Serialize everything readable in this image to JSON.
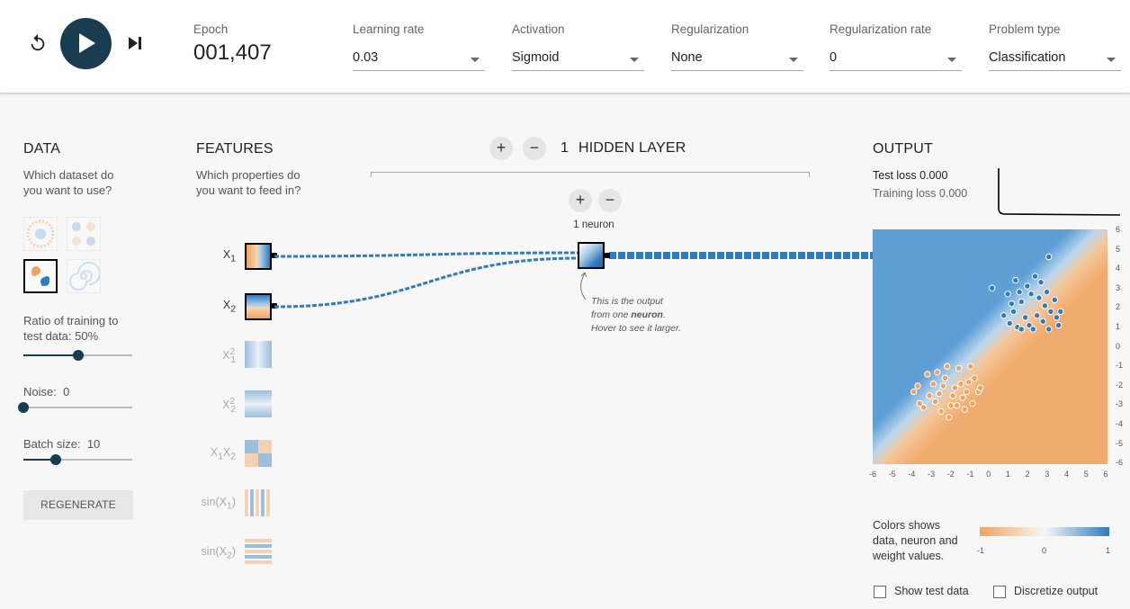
{
  "controls": {
    "reset_icon": "reset-icon",
    "play_icon": "play-icon",
    "step_icon": "step-forward-icon",
    "epoch_label": "Epoch",
    "epoch_value": "001,407"
  },
  "selects": {
    "learning_rate": {
      "label": "Learning rate",
      "value": "0.03"
    },
    "activation": {
      "label": "Activation",
      "value": "Sigmoid"
    },
    "regularization": {
      "label": "Regularization",
      "value": "None"
    },
    "regularization_rate": {
      "label": "Regularization rate",
      "value": "0"
    },
    "problem_type": {
      "label": "Problem type",
      "value": "Classification"
    }
  },
  "data_panel": {
    "title": "DATA",
    "subtitle": "Which dataset do you want to use?",
    "selected_dataset": "gaussian",
    "ratio_label": "Ratio of training to test data:",
    "ratio_value": "50%",
    "ratio_fraction": 0.5,
    "noise_label": "Noise:",
    "noise_value": "0",
    "noise_fraction": 0,
    "batch_label": "Batch size:",
    "batch_value": "10",
    "batch_fraction": 0.3,
    "regenerate": "REGENERATE"
  },
  "features_panel": {
    "title": "FEATURES",
    "subtitle": "Which properties do you want to feed in?",
    "features": [
      {
        "id": "x1",
        "base": "X",
        "sub": "1",
        "sup": "",
        "active": true
      },
      {
        "id": "x2",
        "base": "X",
        "sub": "2",
        "sup": "",
        "active": true
      },
      {
        "id": "x1sq",
        "base": "X",
        "sub": "1",
        "sup": "2",
        "active": false
      },
      {
        "id": "x2sq",
        "base": "X",
        "sub": "2",
        "sup": "2",
        "active": false
      },
      {
        "id": "x1x2",
        "base": "X1X2",
        "sub": "",
        "sup": "",
        "active": false
      },
      {
        "id": "sinx1",
        "base": "sin(X",
        "sub": "1",
        "sup": ")",
        "active": false
      },
      {
        "id": "sinx2",
        "base": "sin(X",
        "sub": "2",
        "sup": ")",
        "active": false
      }
    ]
  },
  "network": {
    "hidden_count": "1",
    "hidden_label": "HIDDEN LAYER",
    "neuron_count_label": "1 neuron",
    "plus": "+",
    "minus": "−",
    "callout_1": "This is the output from one ",
    "callout_bold": "neuron",
    "callout_2": ". Hover to see it larger."
  },
  "output_panel": {
    "title": "OUTPUT",
    "test_loss_label": "Test loss",
    "test_loss": "0.000",
    "training_loss_label": "Training loss",
    "training_loss": "0.000",
    "y_ticks": [
      "6",
      "5",
      "4",
      "3",
      "2",
      "1",
      "0",
      "-1",
      "-2",
      "-3",
      "-4",
      "-5",
      "-6"
    ],
    "x_ticks": [
      "-6",
      "-5",
      "-4",
      "-3",
      "-2",
      "-1",
      "0",
      "1",
      "2",
      "3",
      "4",
      "5",
      "6"
    ],
    "legend_text": "Colors shows data, neuron and weight values.",
    "legend_ticks": [
      "-1",
      "0",
      "1"
    ],
    "show_test_label": "Show test data",
    "discretize_label": "Discretize output"
  },
  "colors": {
    "positive": "#2e7bc0",
    "negative": "#f0a35e",
    "accent": "#183d4e"
  },
  "chart_data": {
    "type": "scatter",
    "xlim": [
      -6,
      6
    ],
    "ylim": [
      -6,
      6
    ],
    "series": [
      {
        "values": [
          [
            2.1,
            2.7
          ],
          [
            1.6,
            2.3
          ],
          [
            2.4,
            1.6
          ],
          [
            2.0,
            1.1
          ],
          [
            1.2,
            1.8
          ],
          [
            2.8,
            2.1
          ],
          [
            3.1,
            1.8
          ],
          [
            3.4,
            1.5
          ],
          [
            1.9,
            3.1
          ],
          [
            2.6,
            3.3
          ],
          [
            1.3,
            3.4
          ],
          [
            0.9,
            2.7
          ],
          [
            0.7,
            1.6
          ],
          [
            1.4,
            1.0
          ],
          [
            2.2,
            0.9
          ],
          [
            3.0,
            0.9
          ],
          [
            3.5,
            1.1
          ],
          [
            2.5,
            2.5
          ],
          [
            1.8,
            1.5
          ],
          [
            2.9,
            2.8
          ],
          [
            1.1,
            2.2
          ],
          [
            2.3,
            3.6
          ],
          [
            3.3,
            2.4
          ],
          [
            1.5,
            2.8
          ],
          [
            2.7,
            1.3
          ],
          [
            3.0,
            4.6
          ],
          [
            0.1,
            3.0
          ],
          [
            1.0,
            1.2
          ],
          [
            3.6,
            1.8
          ],
          [
            1.6,
            0.9
          ]
        ]
      },
      {
        "values": [
          [
            -1.8,
            -2.1
          ],
          [
            -2.3,
            -1.6
          ],
          [
            -1.4,
            -2.6
          ],
          [
            -2.0,
            -3.0
          ],
          [
            -1.1,
            -1.8
          ],
          [
            -2.6,
            -2.4
          ],
          [
            -2.9,
            -1.9
          ],
          [
            -3.1,
            -2.5
          ],
          [
            -1.6,
            -1.1
          ],
          [
            -2.2,
            -1.0
          ],
          [
            -0.9,
            -2.9
          ],
          [
            -1.3,
            -3.2
          ],
          [
            -2.5,
            -3.3
          ],
          [
            -0.8,
            -1.6
          ],
          [
            -1.0,
            -1.0
          ],
          [
            -3.2,
            -1.4
          ],
          [
            -3.7,
            -2.0
          ],
          [
            -2.8,
            -2.8
          ],
          [
            -1.9,
            -2.5
          ],
          [
            -2.4,
            -2.0
          ],
          [
            -1.5,
            -1.9
          ],
          [
            -0.6,
            -2.3
          ],
          [
            -3.4,
            -3.1
          ],
          [
            -2.1,
            -3.6
          ],
          [
            -1.2,
            -2.3
          ],
          [
            -3.9,
            -2.3
          ],
          [
            -3.6,
            -2.9
          ],
          [
            -2.7,
            -1.3
          ],
          [
            -1.7,
            -3.0
          ],
          [
            -0.5,
            -2.1
          ]
        ]
      }
    ]
  }
}
